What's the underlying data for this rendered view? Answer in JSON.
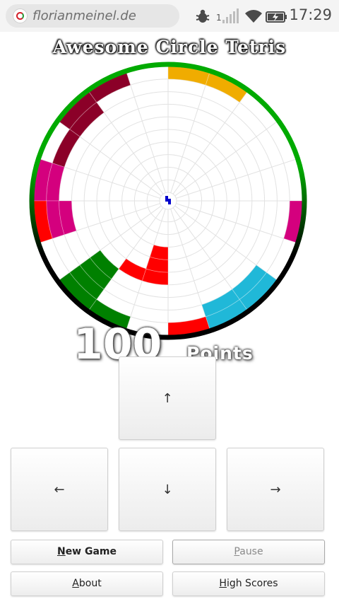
{
  "status_bar": {
    "url": "florianmeinel.de",
    "sim_number": "1",
    "time": "17:29",
    "icons": [
      "site-favicon",
      "bug-icon",
      "signal-icon",
      "wifi-icon",
      "battery-charging-icon"
    ]
  },
  "game": {
    "title": "Awesome Circle Tetris",
    "score_value": "100",
    "score_unit": "Points",
    "border_colors": {
      "top": "#00aa00",
      "bottom": "#000000"
    },
    "board": {
      "rings": 10,
      "sectors": 20,
      "grid_color": "#e2e2e2",
      "blocks": [
        {
          "color": "#f0ac00",
          "cells": [
            [
              9,
              0
            ],
            [
              9,
              1
            ]
          ]
        },
        {
          "color": "#8b0028",
          "cells": [
            [
              9,
              18
            ],
            [
              9,
              17
            ],
            [
              8,
              17
            ],
            [
              8,
              16
            ]
          ]
        },
        {
          "color": "#d4007e",
          "cells": [
            [
              9,
              15
            ],
            [
              8,
              15
            ],
            [
              8,
              14
            ],
            [
              7,
              14
            ]
          ]
        },
        {
          "color": "#ff0000",
          "cells": [
            [
              9,
              14
            ]
          ]
        },
        {
          "color": "#d4007e",
          "cells": [
            [
              9,
              5
            ]
          ]
        },
        {
          "color": "#008000",
          "cells": [
            [
              9,
              11
            ],
            [
              9,
              12
            ],
            [
              8,
              12
            ],
            [
              7,
              12
            ],
            [
              6,
              12
            ]
          ]
        },
        {
          "color": "#ff0000",
          "cells": [
            [
              5,
              10
            ],
            [
              4,
              10
            ],
            [
              3,
              10
            ],
            [
              5,
              11
            ]
          ]
        },
        {
          "color": "#20b8d8",
          "cells": [
            [
              9,
              8
            ],
            [
              9,
              7
            ],
            [
              8,
              8
            ],
            [
              8,
              7
            ]
          ]
        },
        {
          "color": "#ff0000",
          "cells": [
            [
              9,
              9
            ]
          ]
        }
      ],
      "falling_piece_color": "#0000cc"
    }
  },
  "controls": {
    "up": "↑",
    "left": "←",
    "down": "↓",
    "right": "→",
    "new_game": {
      "accesskey": "N",
      "rest": "ew Game"
    },
    "pause": {
      "accesskey": "P",
      "rest": "ause"
    },
    "about": {
      "accesskey": "A",
      "rest": "bout"
    },
    "high_scores": {
      "accesskey": "H",
      "rest": "igh Scores"
    }
  }
}
